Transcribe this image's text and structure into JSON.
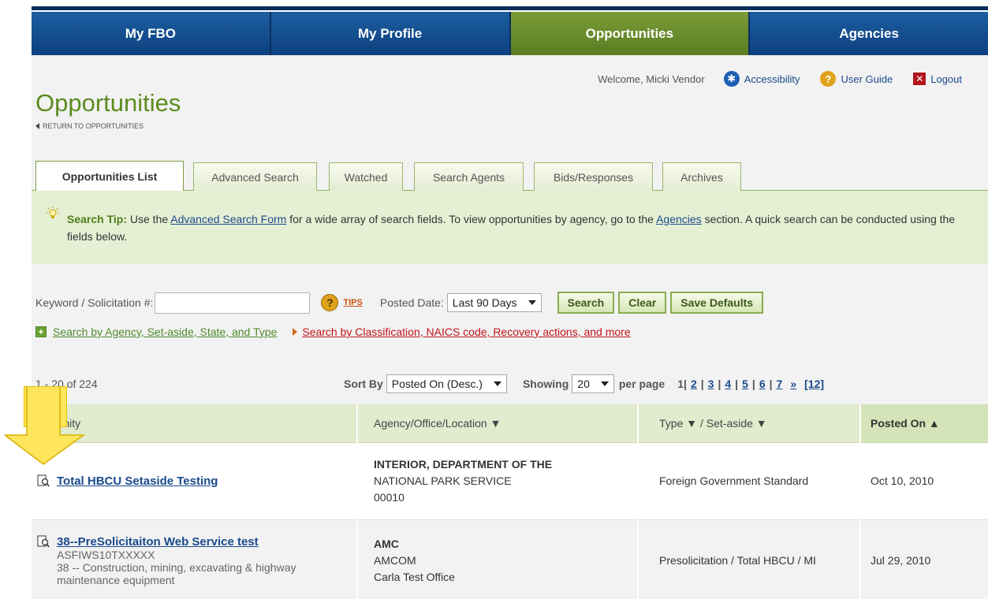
{
  "nav": {
    "items": [
      {
        "label": "My FBO"
      },
      {
        "label": "My Profile"
      },
      {
        "label": "Opportunities"
      },
      {
        "label": "Agencies"
      }
    ]
  },
  "util": {
    "welcome": "Welcome, Micki Vendor",
    "accessibility": "Accessibility",
    "user_guide": "User Guide",
    "logout": "Logout",
    "accessibility_icon_glyph": "✱",
    "help_icon_glyph": "?",
    "logout_icon_glyph": "✕"
  },
  "page": {
    "title": "Opportunities",
    "return_link": "RETURN TO OPPORTUNITIES"
  },
  "tabs": [
    {
      "label": "Opportunities List"
    },
    {
      "label": "Advanced Search"
    },
    {
      "label": "Watched"
    },
    {
      "label": "Search Agents"
    },
    {
      "label": "Bids/Responses"
    },
    {
      "label": "Archives"
    }
  ],
  "tip": {
    "label": "Search Tip:",
    "text1": " Use the ",
    "link1": "Advanced Search Form",
    "text2": " for a wide array of search fields. To view opportunities by agency, go to the ",
    "link2": "Agencies",
    "text3": " section. A quick search can be conducted using the fields below."
  },
  "search": {
    "keyword_label": "Keyword / Solicitation #:",
    "keyword_value": "",
    "tips_icon_glyph": "?",
    "tips_link": "TIPS",
    "posted_date_label": "Posted Date:",
    "posted_date_value": "Last 90 Days",
    "search_button": "Search",
    "clear_button": "Clear",
    "save_defaults_button": "Save Defaults",
    "plus_glyph": "+",
    "agency_link": "Search by Agency, Set-aside, State, and Type",
    "classification_link": "Search by Classification, NAICS code, Recovery actions, and more"
  },
  "results": {
    "count": "1 - 20 of 224",
    "sort_by_label": "Sort By",
    "sort_by_value": "Posted On (Desc.)",
    "showing_label": "Showing",
    "showing_value": "20",
    "per_page_label": "per page",
    "current_page": "1",
    "pages": [
      "2",
      "3",
      "4",
      "5",
      "6",
      "7"
    ],
    "next": "»",
    "last": "[12]",
    "sep": "|"
  },
  "table": {
    "headers": {
      "opportunity": "rtunity",
      "agency": "Agency/Office/Location ▼",
      "type": "Type ▼ / Set-aside ▼",
      "posted": "Posted On ▲"
    },
    "rows": [
      {
        "title": "Total HBCU Setaside Testing",
        "solicitation": "",
        "classification": "",
        "agency_lines": [
          "INTERIOR, DEPARTMENT OF THE",
          "NATIONAL PARK SERVICE",
          "00010"
        ],
        "type": "Foreign Government Standard",
        "posted": "Oct 10, 2010"
      },
      {
        "title": "38--PreSolicitaiton Web Service test",
        "solicitation": "ASFIWS10TXXXXX",
        "classification": "38 -- Construction, mining, excavating & highway maintenance equipment",
        "agency_lines": [
          "AMC",
          "AMCOM",
          "Carla Test Office"
        ],
        "type": "Presolicitation / Total HBCU / MI",
        "posted": "Jul 29, 2010"
      }
    ]
  },
  "callout": {
    "label": "I",
    "color": "#fde55c"
  }
}
